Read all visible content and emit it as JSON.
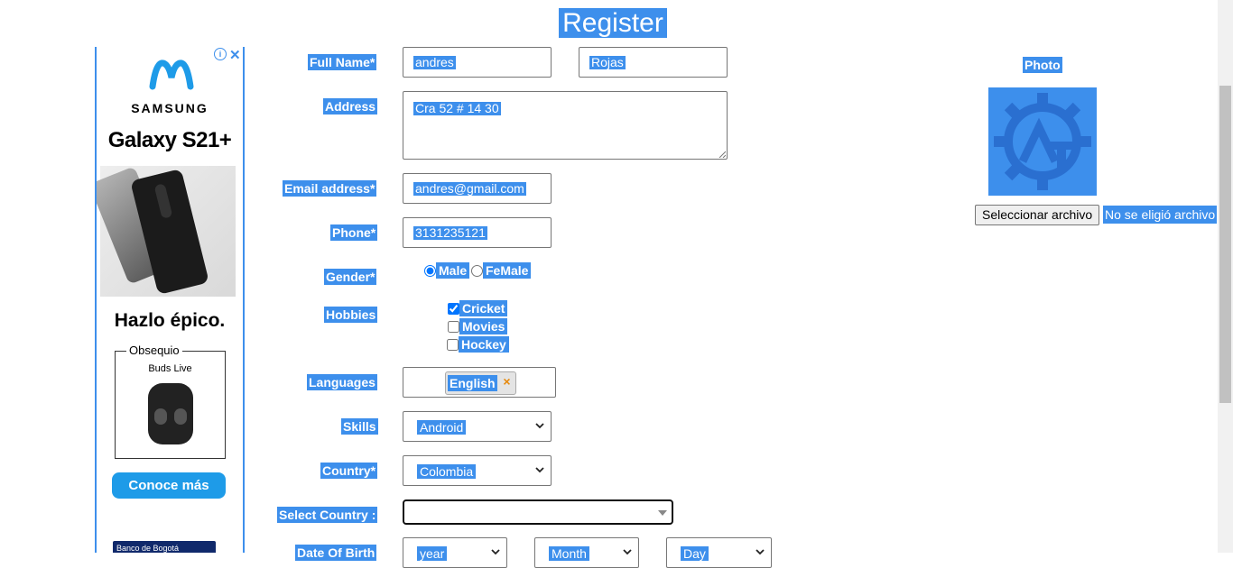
{
  "page": {
    "title": "Register"
  },
  "ad": {
    "brand": "M",
    "maker": "SAMSUNG",
    "model": "Galaxy S21+",
    "slogan": "Hazlo épico.",
    "gift_label": "Obsequio",
    "gift_item": "Buds Live",
    "cta": "Conoce más",
    "bank": "Banco de Bogotá",
    "info_icon": "info-icon",
    "close_icon": "close-icon"
  },
  "form": {
    "full_name": {
      "label": "Full Name*",
      "first": "andres",
      "last": "Rojas"
    },
    "address": {
      "label": "Address",
      "value": "Cra 52 # 14 30"
    },
    "email": {
      "label": "Email address*",
      "value": "andres@gmail.com"
    },
    "phone": {
      "label": "Phone*",
      "value": "3131235121"
    },
    "gender": {
      "label": "Gender*",
      "options": [
        "Male",
        "FeMale"
      ],
      "selected": "Male"
    },
    "hobbies": {
      "label": "Hobbies",
      "options": [
        "Cricket",
        "Movies",
        "Hockey"
      ],
      "checked": [
        "Cricket"
      ]
    },
    "languages": {
      "label": "Languages",
      "chip": "English",
      "chip_remove": "×"
    },
    "skills": {
      "label": "Skills",
      "value": "Android"
    },
    "country": {
      "label": "Country*",
      "value": "Colombia"
    },
    "select_country": {
      "label": "Select Country :",
      "value": ""
    },
    "dob": {
      "label": "Date Of Birth",
      "year": "year",
      "month": "Month",
      "day": "Day"
    }
  },
  "photo": {
    "label": "Photo",
    "file_button": "Seleccionar archivo",
    "file_status": "No se eligió archivo",
    "logo_color": "#3d8fec",
    "logo_icon": "gear-logo-icon"
  },
  "colors": {
    "selection": "#3d8fec"
  }
}
